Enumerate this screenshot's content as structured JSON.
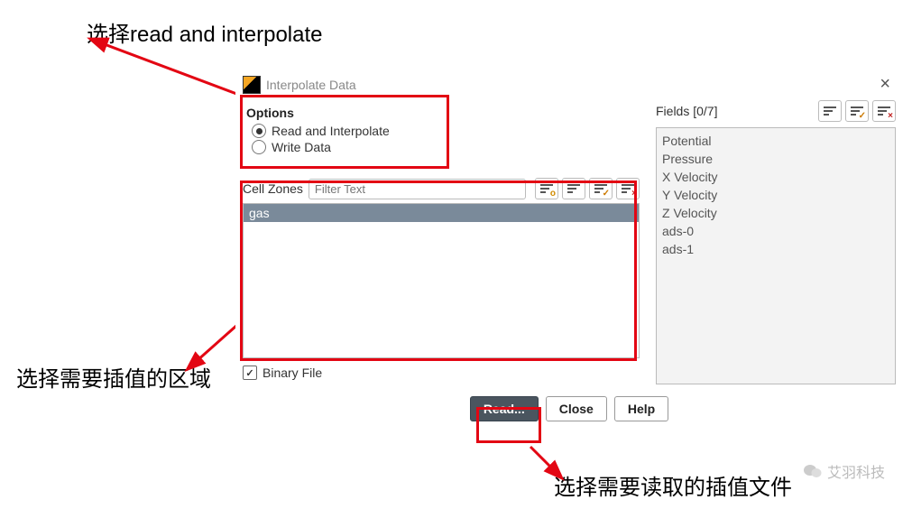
{
  "annotations": {
    "top": "选择read and interpolate",
    "left": "选择需要插值的区域",
    "bottom": "选择需要读取的插值文件"
  },
  "dialog": {
    "title": "Interpolate Data",
    "options": {
      "heading": "Options",
      "read": "Read and Interpolate",
      "write": "Write Data"
    },
    "cellzones": {
      "label": "Cell Zones",
      "filter_placeholder": "Filter Text",
      "items": [
        "gas"
      ]
    },
    "binary_label": "Binary File",
    "fields": {
      "label": "Fields [0/7]",
      "items": [
        "Potential",
        "Pressure",
        "X Velocity",
        "Y Velocity",
        "Z Velocity",
        "ads-0",
        "ads-1"
      ]
    },
    "buttons": {
      "read": "Read...",
      "close": "Close",
      "help": "Help"
    }
  },
  "watermark": "艾羽科技"
}
